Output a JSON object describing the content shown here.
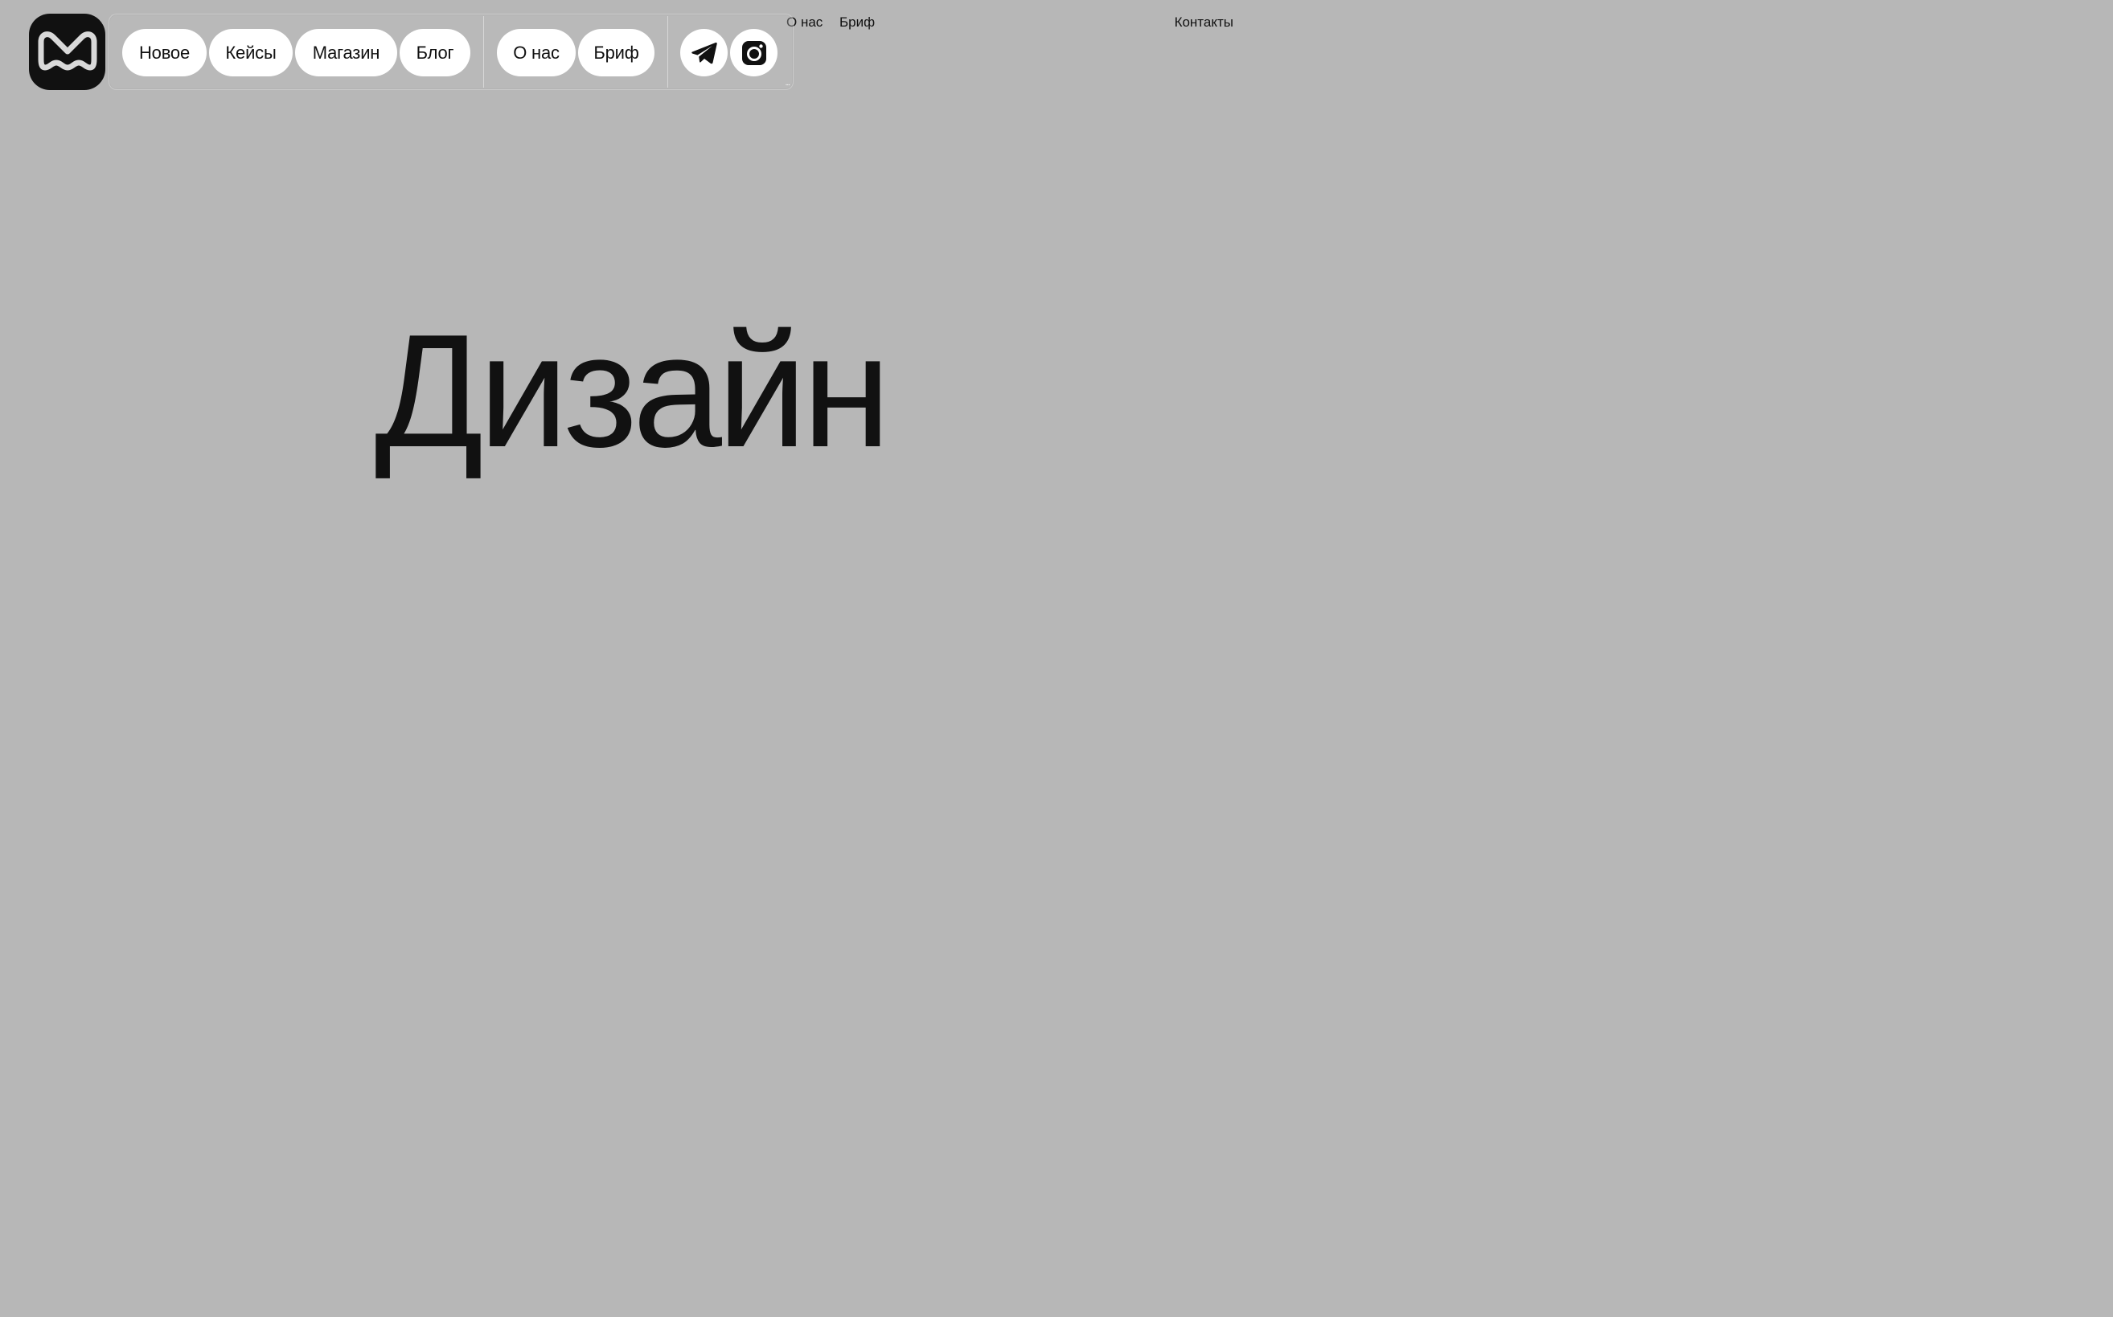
{
  "background_nav": {
    "about_label": "О нас",
    "brief_label": "Бриф",
    "contacts_label": "Контакты"
  },
  "logo": {
    "icon": "m-logo-icon"
  },
  "nav": {
    "items": [
      {
        "label": "Новое"
      },
      {
        "label": "Кейсы"
      },
      {
        "label": "Магазин"
      },
      {
        "label": "Блог"
      }
    ],
    "secondary": [
      {
        "label": "О нас"
      },
      {
        "label": "Бриф"
      }
    ],
    "social": [
      {
        "icon": "telegram-icon"
      },
      {
        "icon": "instagram-icon"
      }
    ],
    "more_label": "..."
  },
  "hero": {
    "title": "Дизайн"
  },
  "colors": {
    "background": "#b7b7b7",
    "text": "#111111",
    "pill": "#ffffff",
    "logo_bg": "#111111"
  }
}
